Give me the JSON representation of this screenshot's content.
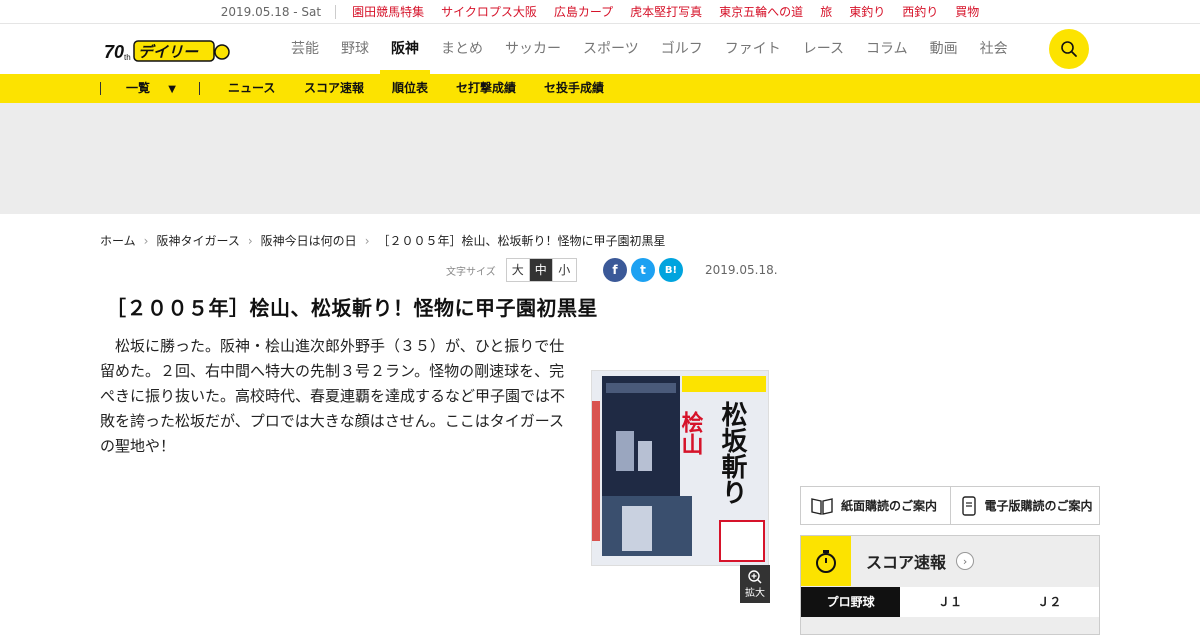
{
  "topbar": {
    "date": "2019.05.18 - Sat",
    "links": [
      "園田競馬特集",
      "サイクロプス大阪",
      "広島カープ",
      "虎本堅打写真",
      "東京五輪への道",
      "旅",
      "東釣り",
      "西釣り",
      "買物"
    ]
  },
  "header": {
    "logo_text": "デイリー",
    "nav": [
      "芸能",
      "野球",
      "阪神",
      "まとめ",
      "サッカー",
      "スポーツ",
      "ゴルフ",
      "ファイト",
      "レース",
      "コラム",
      "動画",
      "社会"
    ],
    "active_nav": "阪神"
  },
  "subnav": {
    "list_label": "一覧",
    "items": [
      "ニュース",
      "スコア速報",
      "順位表",
      "セ打撃成績",
      "セ投手成績"
    ]
  },
  "breadcrumb": [
    "ホーム",
    "阪神タイガース",
    "阪神今日は何の日",
    "［２００５年］桧山、松坂斬り！怪物に甲子園初黒星"
  ],
  "textsize": {
    "caption": "文字サイズ",
    "options": [
      "大",
      "中",
      "小"
    ],
    "selected": "中"
  },
  "share": {
    "facebook": "f",
    "twitter": "t",
    "hatena": "B!"
  },
  "article": {
    "date": "2019.05.18.",
    "title": "［２００５年］桧山、松坂斬り！怪物に甲子園初黒星",
    "body": "　松坂に勝った。阪神・桧山進次郎外野手（３５）が、ひと振りで仕留めた。２回、右中間へ特大の先制３号２ラン。怪物の剛速球を、完ぺきに振り抜いた。高校時代、春夏連覇を達成するなど甲子園では不敗を誇った松坂だが、プロでは大きな顔はさせん。ここはタイガースの聖地や！",
    "zoom_label": "拡大",
    "photo_headline_1": "桧山",
    "photo_headline_2": "松坂斬り"
  },
  "sidebar": {
    "print_subscription": "紙面購読のご案内",
    "digital_subscription": "電子版購読のご案内",
    "score_title": "スコア速報",
    "tabs": [
      "プロ野球",
      "Ｊ１",
      "Ｊ２"
    ],
    "active_tab": "プロ野球"
  },
  "colors": {
    "brand_yellow": "#fce300",
    "topbar_link": "#d6132a",
    "facebook": "#3b5998",
    "twitter": "#1da1f2",
    "hatena": "#00a4de"
  }
}
